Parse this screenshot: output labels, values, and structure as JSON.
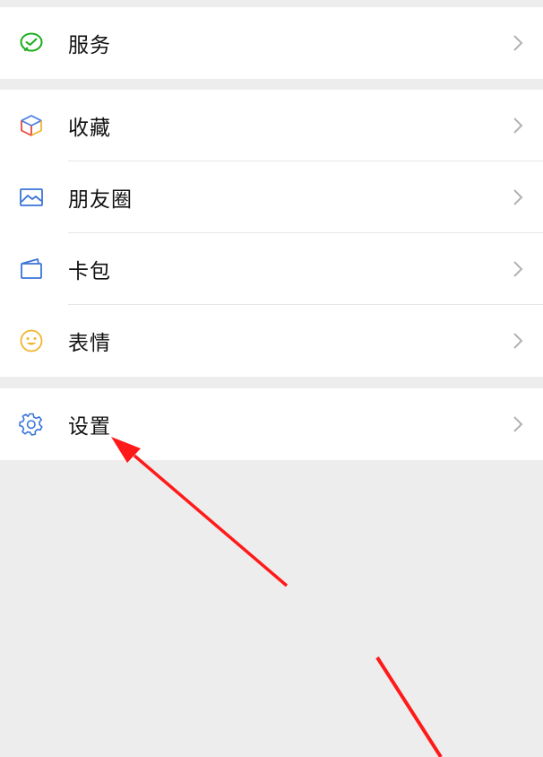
{
  "groups": [
    {
      "items": [
        {
          "label": "服务",
          "icon": "wechat-pay-icon"
        }
      ]
    },
    {
      "items": [
        {
          "label": "收藏",
          "icon": "favorites-cube-icon"
        },
        {
          "label": "朋友圈",
          "icon": "moments-picture-icon"
        },
        {
          "label": "卡包",
          "icon": "card-wallet-icon"
        },
        {
          "label": "表情",
          "icon": "smiley-icon"
        }
      ]
    },
    {
      "items": [
        {
          "label": "设置",
          "icon": "settings-gear-icon"
        }
      ]
    }
  ],
  "colors": {
    "background": "#ededed",
    "row": "#ffffff",
    "text": "#111111",
    "chevron": "#b2b2b2",
    "annotation_arrow": "#ff1a1a",
    "service_icon": "#1aad19",
    "settings_icon": "#3a74d8",
    "smiley_icon": "#f1b52c"
  }
}
